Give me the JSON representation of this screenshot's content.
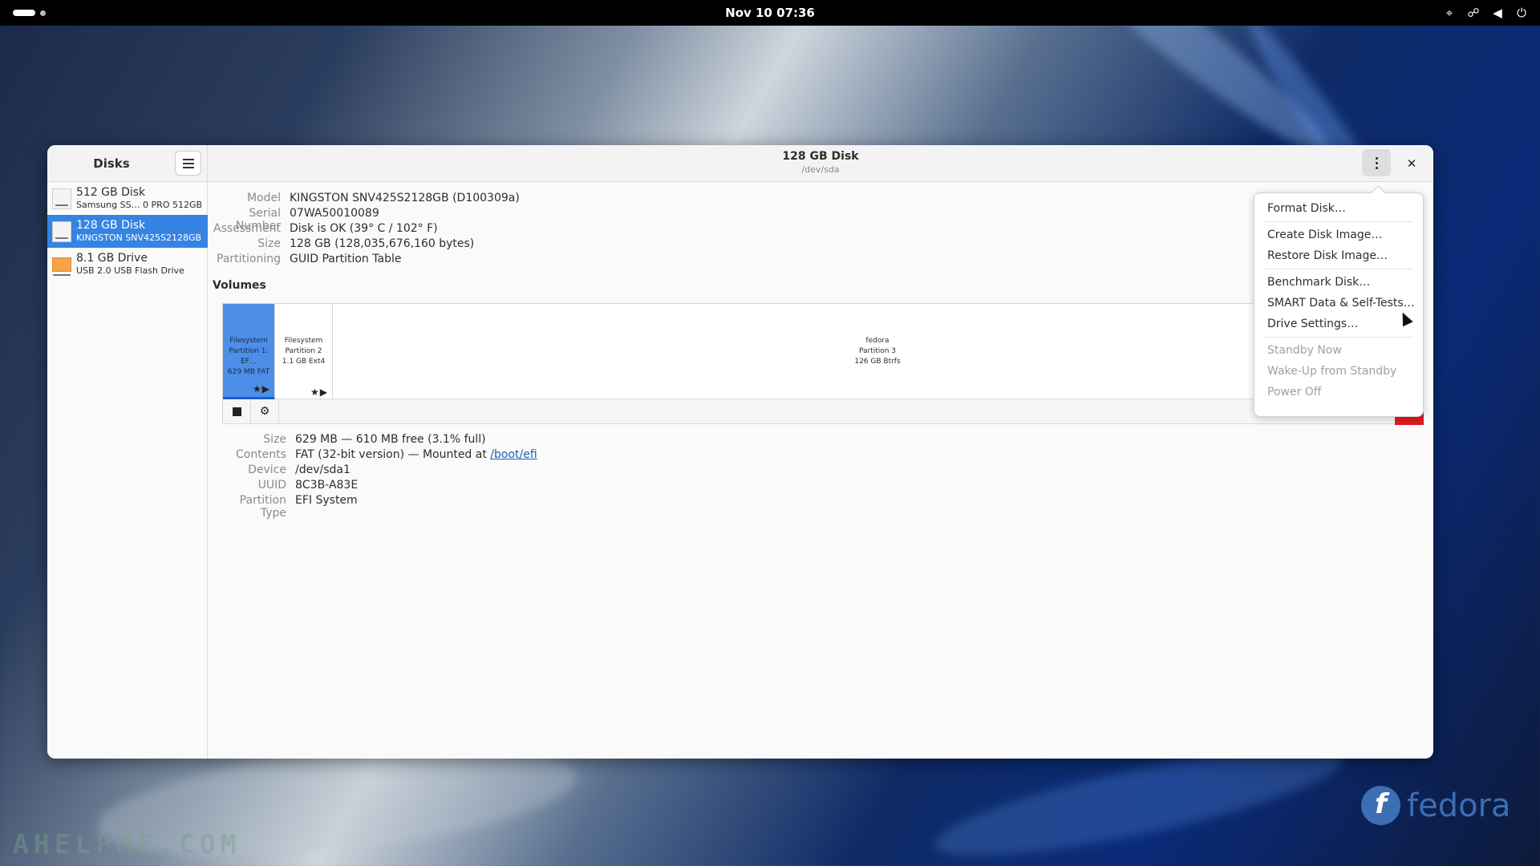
{
  "topbar": {
    "clock": "Nov 10  07:36",
    "tray_icons": [
      "location-icon",
      "network-icon",
      "volume-icon",
      "power-icon"
    ]
  },
  "sidebar": {
    "title": "Disks",
    "items": [
      {
        "name": "512 GB Disk",
        "sub": "Samsung SS…   0 PRO 512GB",
        "icon": "hdd-icon"
      },
      {
        "name": "128 GB Disk",
        "sub": "KINGSTON SNV425S2128GB",
        "icon": "hdd-icon"
      },
      {
        "name": "8.1 GB Drive",
        "sub": "USB 2.0 USB Flash Drive",
        "icon": "usb-drive-icon"
      }
    ]
  },
  "header": {
    "title": "128 GB Disk",
    "subtitle": "/dev/sda",
    "close_glyph": "✕"
  },
  "drive_info": [
    {
      "label": "Model",
      "value": "KINGSTON SNV425S2128GB (D100309a)"
    },
    {
      "label": "Serial Number",
      "value": "07WA50010089"
    },
    {
      "label": "Assessment",
      "value": "Disk is OK (39° C / 102° F)"
    },
    {
      "label": "Size",
      "value": "128 GB (128,035,676,160 bytes)"
    },
    {
      "label": "Partitioning",
      "value": "GUID Partition Table"
    }
  ],
  "volumes": {
    "label": "Volumes",
    "partitions": [
      {
        "line1": "Filesystem",
        "line2": "Partition 1: EF…",
        "line3": "629 MB FAT",
        "marks": "★▶"
      },
      {
        "line1": "Filesystem",
        "line2": "Partition 2",
        "line3": "1.1 GB Ext4",
        "marks": "★▶"
      },
      {
        "line1": "fedora",
        "line2": "Partition 3",
        "line3": "126 GB Btrfs",
        "marks": ""
      }
    ]
  },
  "partition_details": {
    "size_label": "Size",
    "size_value": "629 MB — 610 MB free (3.1% full)",
    "contents_label": "Contents",
    "contents_value": "FAT (32-bit version) — Mounted at ",
    "contents_link": "/boot/efi",
    "device_label": "Device",
    "device_value": "/dev/sda1",
    "uuid_label": "UUID",
    "uuid_value": "8C3B-A83E",
    "type_label": "Partition Type",
    "type_value": "EFI System"
  },
  "menu": {
    "items": [
      {
        "label": "Format Disk…",
        "enabled": true
      },
      {
        "label": "Create Disk Image…",
        "enabled": true
      },
      {
        "label": "Restore Disk Image…",
        "enabled": true
      },
      {
        "label": "Benchmark Disk…",
        "enabled": true
      },
      {
        "label": "SMART Data & Self-Tests…",
        "enabled": true
      },
      {
        "label": "Drive Settings…",
        "enabled": true
      },
      {
        "label": "Standby Now",
        "enabled": false
      },
      {
        "label": "Wake-Up from Standby",
        "enabled": false
      },
      {
        "label": "Power Off",
        "enabled": false
      }
    ]
  },
  "desktop": {
    "watermark": "AHELPME.COM",
    "logo_text": "fedora",
    "logo_glyph": "f",
    "accent": "#3584e4",
    "fedora_blue": "#3c6eb4"
  }
}
